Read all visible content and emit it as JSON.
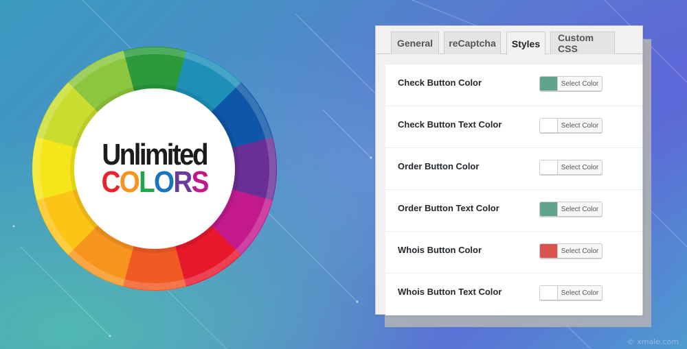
{
  "logo": {
    "line1": "Unlimited",
    "line2_letters": [
      {
        "char": "C",
        "color": "#e8232a"
      },
      {
        "char": "O",
        "color": "#f7931e"
      },
      {
        "char": "L",
        "color": "#1fa64a"
      },
      {
        "char": "O",
        "color": "#1b75bc"
      },
      {
        "char": "R",
        "color": "#6a3b9a"
      },
      {
        "char": "S",
        "color": "#c2188a"
      }
    ]
  },
  "wheel_colors": [
    "#2a9a3c",
    "#1e90b8",
    "#0e56a8",
    "#6a2f94",
    "#c21a8d",
    "#e8182c",
    "#f25a24",
    "#f7941d",
    "#fcc417",
    "#f5e61a",
    "#cadd2f",
    "#8cc63e"
  ],
  "tabs": [
    {
      "label": "General",
      "active": false
    },
    {
      "label": "reCaptcha",
      "active": false
    },
    {
      "label": "Styles",
      "active": true
    },
    {
      "label": "Custom CSS",
      "active": false
    }
  ],
  "rows": [
    {
      "label": "Check Button Color",
      "button_label": "Select Color",
      "color": "#5fa38f"
    },
    {
      "label": "Check Button Text Color",
      "button_label": "Select Color",
      "color": "#ffffff"
    },
    {
      "label": "Order Button Color",
      "button_label": "Select Color",
      "color": "#ffffff"
    },
    {
      "label": "Order Button Text Color",
      "button_label": "Select Color",
      "color": "#5fa38f"
    },
    {
      "label": "Whois Button Color",
      "button_label": "Select Color",
      "color": "#d9534f"
    },
    {
      "label": "Whois Button Text Color",
      "button_label": "Select Color",
      "color": "#ffffff"
    }
  ],
  "watermark": "© xmale.com"
}
